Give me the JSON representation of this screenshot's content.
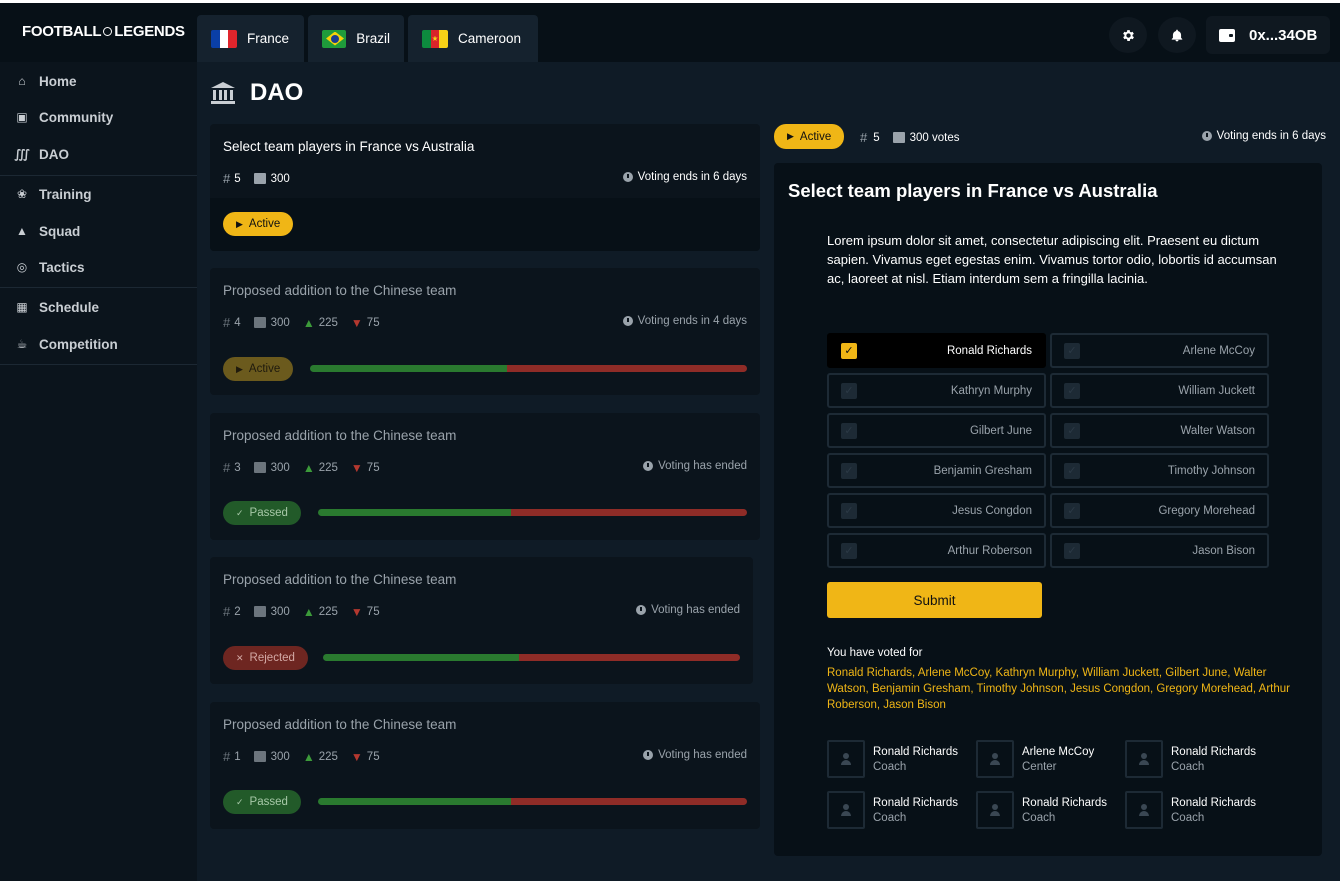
{
  "header": {
    "logo_left": "FOOTBALL",
    "logo_right": "LEGENDS",
    "tabs": [
      {
        "label": "France",
        "flag": "flag-france-icon"
      },
      {
        "label": "Brazil",
        "flag": "flag-brazil-icon"
      },
      {
        "label": "Cameroon",
        "flag": "flag-cameroon-icon"
      }
    ],
    "wallet_address": "0x...34OB"
  },
  "sidebar": {
    "items": [
      {
        "label": "Home",
        "icon": "home-icon"
      },
      {
        "label": "Community",
        "icon": "community-icon"
      },
      {
        "label": "DAO",
        "icon": "bank-icon"
      },
      {
        "label": "Training",
        "icon": "running-icon"
      },
      {
        "label": "Squad",
        "icon": "shirt-icon"
      },
      {
        "label": "Tactics",
        "icon": "target-icon"
      },
      {
        "label": "Schedule",
        "icon": "calendar-icon"
      },
      {
        "label": "Competition",
        "icon": "trophy-icon"
      }
    ]
  },
  "page": {
    "title": "DAO"
  },
  "proposals": [
    {
      "title": "Select team players in France vs Australia",
      "id": "5",
      "votes": "300",
      "ends": "Voting ends in 6 days",
      "status": "Active"
    },
    {
      "title": "Proposed addition to the Chinese team",
      "id": "4",
      "votes": "300",
      "up": "225",
      "down": "75",
      "ends": "Voting ends in 4 days",
      "status": "Active",
      "yes_share": 0.45
    },
    {
      "title": "Proposed addition to the Chinese team",
      "id": "3",
      "votes": "300",
      "up": "225",
      "down": "75",
      "ends": "Voting has ended",
      "status": "Passed",
      "yes_share": 0.45
    },
    {
      "title": "Proposed addition to the Chinese team",
      "id": "2",
      "votes": "300",
      "up": "225",
      "down": "75",
      "ends": "Voting has ended",
      "status": "Rejected",
      "yes_share": 0.47
    },
    {
      "title": "Proposed addition to the Chinese team",
      "id": "1",
      "votes": "300",
      "up": "225",
      "down": "75",
      "ends": "Voting has ended",
      "status": "Passed",
      "yes_share": 0.45
    }
  ],
  "detail": {
    "status": "Active",
    "id": "5",
    "votes": "300 votes",
    "ends": "Voting ends in 6 days",
    "title": "Select team players in France vs Australia",
    "description": "Lorem ipsum dolor sit amet, consectetur adipiscing elit. Praesent eu dictum sapien. Vivamus eget egestas enim. Vivamus tortor odio, lobortis id accumsan ac, laoreet at nisl. Etiam interdum sem a fringilla lacinia.",
    "players": [
      {
        "name": "Ronald Richards",
        "selected": true
      },
      {
        "name": "Arlene McCoy",
        "selected": false
      },
      {
        "name": "Kathryn Murphy",
        "selected": false
      },
      {
        "name": "William Juckett",
        "selected": false
      },
      {
        "name": "Gilbert June",
        "selected": false
      },
      {
        "name": "Walter Watson",
        "selected": false
      },
      {
        "name": "Benjamin Gresham",
        "selected": false
      },
      {
        "name": "Timothy Johnson",
        "selected": false
      },
      {
        "name": "Jesus Congdon",
        "selected": false
      },
      {
        "name": "Gregory Morehead",
        "selected": false
      },
      {
        "name": "Arthur Roberson",
        "selected": false
      },
      {
        "name": "Jason Bison",
        "selected": false
      }
    ],
    "submit_label": "Submit",
    "voted_label": "You have voted for",
    "voted_for": "Ronald Richards, Arlene McCoy, Kathryn Murphy, William Juckett, Gilbert June, Walter Watson, Benjamin Gresham, Timothy Johnson, Jesus Congdon, Gregory Morehead, Arthur Roberson, Jason Bison",
    "staff": [
      {
        "name": "Ronald Richards",
        "role": "Coach"
      },
      {
        "name": "Arlene McCoy",
        "role": "Center"
      },
      {
        "name": "Ronald Richards",
        "role": "Coach"
      },
      {
        "name": "Ronald Richards",
        "role": "Coach"
      },
      {
        "name": "Ronald Richards",
        "role": "Coach"
      },
      {
        "name": "Ronald Richards",
        "role": "Coach"
      }
    ]
  },
  "colors": {
    "accent": "#f0b616",
    "passed": "#225a29",
    "rejected": "#6e2621",
    "bar_yes": "#2a7a2f",
    "bar_no": "#8f2c27"
  }
}
